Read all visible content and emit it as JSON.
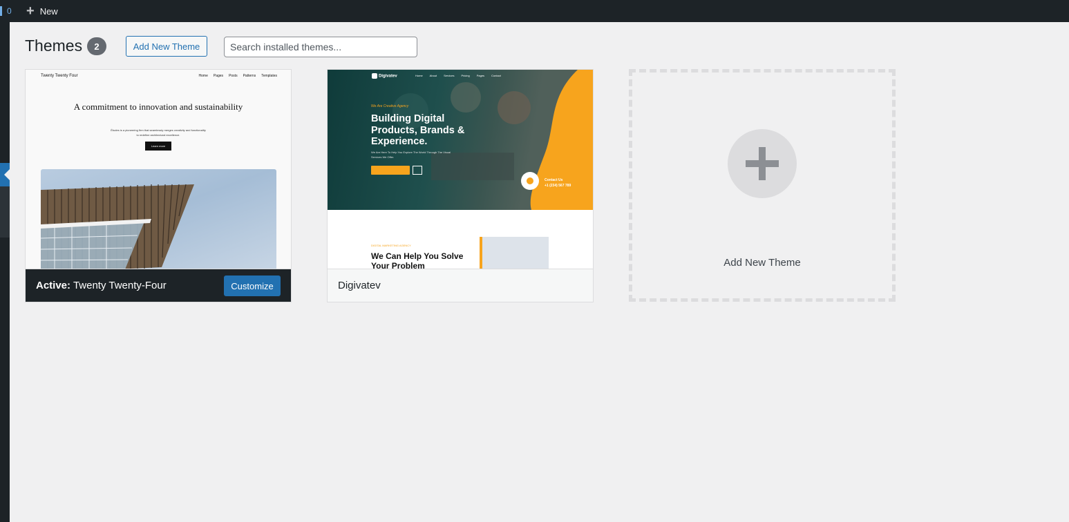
{
  "adminbar": {
    "updates_count": "0",
    "new_label": "New"
  },
  "header": {
    "title": "Themes",
    "count": "2",
    "add_new_label": "Add New Theme",
    "search_placeholder": "Search installed themes..."
  },
  "themes": [
    {
      "active_prefix": "Active:",
      "name": "Twenty Twenty-Four",
      "action_label": "Customize",
      "screenshot": {
        "site_title": "Twenty Twenty Four",
        "nav": [
          "Home",
          "Pages",
          "Posts",
          "Patterns",
          "Templates"
        ],
        "hero_title": "A commitment to innovation and sustainability",
        "hero_sub": "Études is a pioneering firm that seamlessly merges creativity and functionality to redefine architectural excellence.",
        "hero_button": "Learn more"
      }
    },
    {
      "name": "Digivatev",
      "screenshot": {
        "logo": "Digivatev",
        "menu": [
          "Home",
          "About",
          "Services",
          "Pricing",
          "Pages",
          "Contact"
        ],
        "tag": "We Are Creative Agency",
        "headline": "Building Digital Products, Brands & Experience.",
        "lead": "We Are Here To Help You Explore The World Through The Visual Services We Offer.",
        "contact_label": "Contact Us",
        "contact_phone": "+1 (234) 567 789",
        "section_kicker": "DIGITAL MARKETING AGENCY",
        "section_title": "We Can Help You Solve Your Problem"
      }
    }
  ],
  "add_new_card": {
    "label": "Add New Theme",
    "icon": "plus-icon"
  },
  "colors": {
    "admin_dark": "#1d2327",
    "accent_blue": "#2271b1",
    "digivatev_orange": "#f7a41d"
  }
}
